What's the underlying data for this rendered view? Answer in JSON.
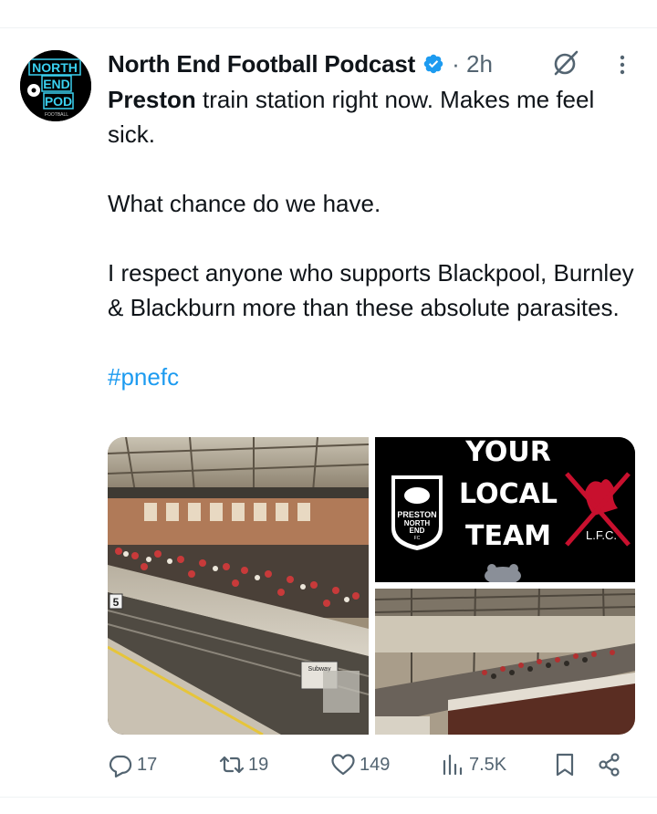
{
  "post": {
    "author_name": "North End Football Podcast",
    "time": "· 2h",
    "avatar": {
      "lines": [
        "NORTH",
        "END",
        "POD"
      ],
      "small_text": "FOOTBALL"
    },
    "text": {
      "mention": "Preston",
      "line1_rest": " train station right now. Makes me feel sick.",
      "line2": "What chance do we have.",
      "line3": "I respect anyone who supports Blackpool, Burnley & Blackburn more than these absolute parasites.",
      "hashtag": "#pnefc"
    },
    "media": {
      "poster": {
        "heading_lines": [
          "YOUR",
          "LOCAL",
          "TEAM"
        ],
        "left_crest_lines": [
          "PRESTON",
          "NORTH",
          "END",
          "FC"
        ],
        "right_crest": "L.F.C."
      },
      "platform": {
        "number": "5",
        "sign": "Subway"
      }
    },
    "stats": {
      "replies": "17",
      "reposts": "19",
      "likes": "149",
      "views": "7.5K"
    },
    "icons": [
      "verified-badge-icon",
      "grok-icon",
      "more-icon",
      "reply-icon",
      "repost-icon",
      "like-icon",
      "views-icon",
      "bookmark-icon",
      "share-icon"
    ],
    "colors": {
      "accent": "#1d9bf0",
      "muted": "#536471",
      "text": "#0f1419"
    }
  }
}
